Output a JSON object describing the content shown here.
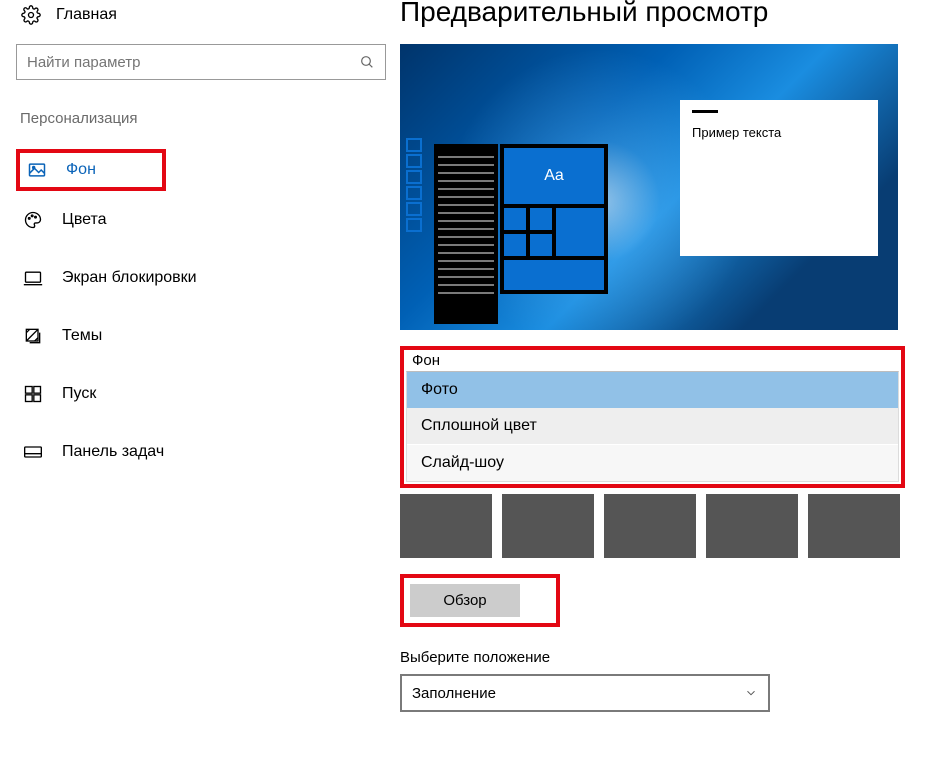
{
  "home_label": "Главная",
  "search_placeholder": "Найти параметр",
  "section_title": "Персонализация",
  "nav": {
    "background": "Фон",
    "colors": "Цвета",
    "lockscreen": "Экран блокировки",
    "themes": "Темы",
    "start": "Пуск",
    "taskbar": "Панель задач"
  },
  "main_title": "Предварительный просмотр",
  "preview": {
    "tile_text": "Aa",
    "window_text": "Пример текста"
  },
  "dropdown": {
    "label": "Фон",
    "options": [
      "Фото",
      "Сплошной цвет",
      "Слайд-шоу"
    ],
    "selected_index": 0
  },
  "browse_label": "Обзор",
  "position_label": "Выберите положение",
  "position_value": "Заполнение"
}
